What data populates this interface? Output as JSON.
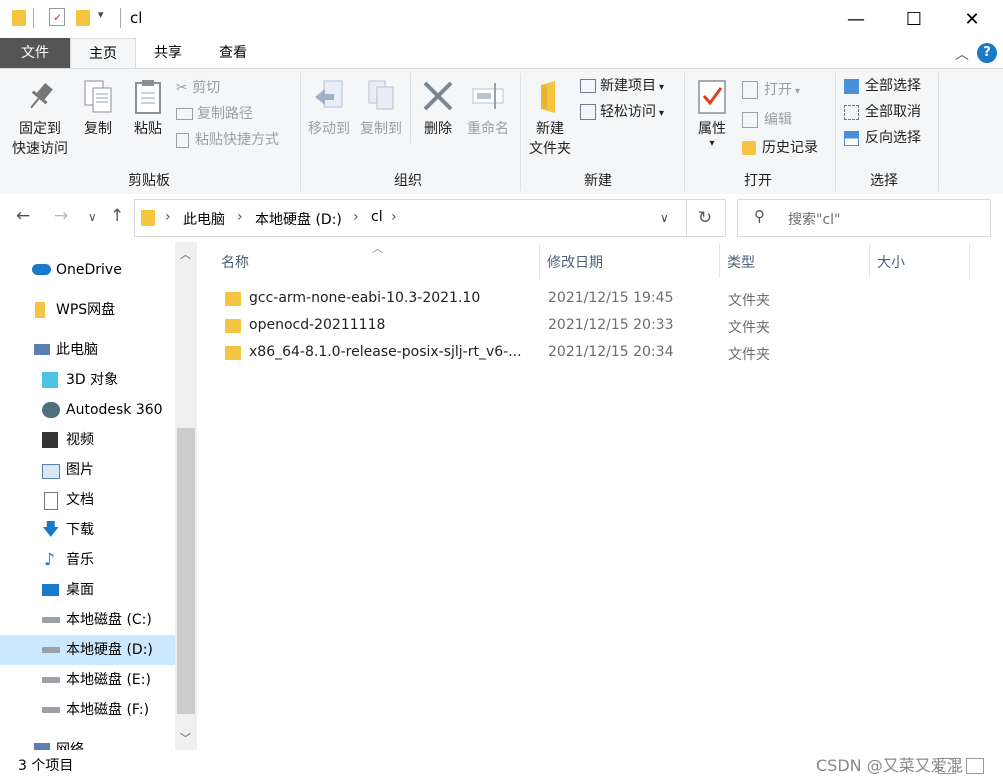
{
  "window": {
    "title": "cl",
    "minimize_glyph": "—",
    "maximize_glyph": "☐",
    "close_glyph": "✕"
  },
  "tabs": [
    {
      "label": "文件"
    },
    {
      "label": "主页"
    },
    {
      "label": "共享"
    },
    {
      "label": "查看"
    }
  ],
  "ribbon": {
    "clipboard": {
      "group": "剪贴板",
      "pin_quick_access": "固定到\n快速访问",
      "pin_line1": "固定到",
      "pin_line2": "快速访问",
      "copy": "复制",
      "paste": "粘贴",
      "cut": "剪切",
      "copy_path": "复制路径",
      "paste_shortcut": "粘贴快捷方式"
    },
    "organize": {
      "group": "组织",
      "move_to": "移动到",
      "copy_to": "复制到",
      "delete": "删除",
      "rename": "重命名"
    },
    "new": {
      "group": "新建",
      "new_folder_line1": "新建",
      "new_folder_line2": "文件夹",
      "new_item": "新建项目",
      "easy_access": "轻松访问"
    },
    "open": {
      "group": "打开",
      "properties": "属性",
      "open": "打开",
      "edit": "编辑",
      "history": "历史记录"
    },
    "select": {
      "group": "选择",
      "select_all": "全部选择",
      "select_none": "全部取消",
      "invert_selection": "反向选择"
    }
  },
  "address": {
    "crumbs": [
      "此电脑",
      "本地硬盘 (D:)",
      "cl"
    ],
    "search_placeholder": "搜索\"cl\""
  },
  "nav": {
    "items": [
      {
        "label": "OneDrive",
        "icon": "cloud-icon"
      },
      {
        "label": "WPS网盘",
        "icon": "folder-icon"
      },
      {
        "label": "此电脑",
        "icon": "computer-icon"
      },
      {
        "label": "3D 对象",
        "icon": "cube-icon"
      },
      {
        "label": "Autodesk 360",
        "icon": "autodesk-icon"
      },
      {
        "label": "视频",
        "icon": "video-icon"
      },
      {
        "label": "图片",
        "icon": "picture-icon"
      },
      {
        "label": "文档",
        "icon": "document-icon"
      },
      {
        "label": "下载",
        "icon": "download-icon"
      },
      {
        "label": "音乐",
        "icon": "music-icon"
      },
      {
        "label": "桌面",
        "icon": "desktop-icon"
      },
      {
        "label": "本地磁盘 (C:)",
        "icon": "drive-icon"
      },
      {
        "label": "本地硬盘 (D:)",
        "icon": "drive-icon"
      },
      {
        "label": "本地磁盘 (E:)",
        "icon": "drive-icon"
      },
      {
        "label": "本地磁盘 (F:)",
        "icon": "drive-icon"
      },
      {
        "label": "网络",
        "icon": "network-icon"
      }
    ],
    "selected": "本地硬盘 (D:)"
  },
  "columns": {
    "name": "名称",
    "date": "修改日期",
    "type": "类型",
    "size": "大小"
  },
  "files": [
    {
      "name": "gcc-arm-none-eabi-10.3-2021.10",
      "date": "2021/12/15 19:45",
      "type": "文件夹"
    },
    {
      "name": "openocd-20211118",
      "date": "2021/12/15 20:33",
      "type": "文件夹"
    },
    {
      "name": "x86_64-8.1.0-release-posix-sjlj-rt_v6-...",
      "date": "2021/12/15 20:34",
      "type": "文件夹"
    }
  ],
  "status": {
    "count": "3 个项目",
    "watermark": "CSDN @又菜又爱混"
  },
  "colors": {
    "file_tab": "#555555",
    "selection": "#cce8ff",
    "folder": "#f5c542",
    "accent": "#1979ca"
  }
}
